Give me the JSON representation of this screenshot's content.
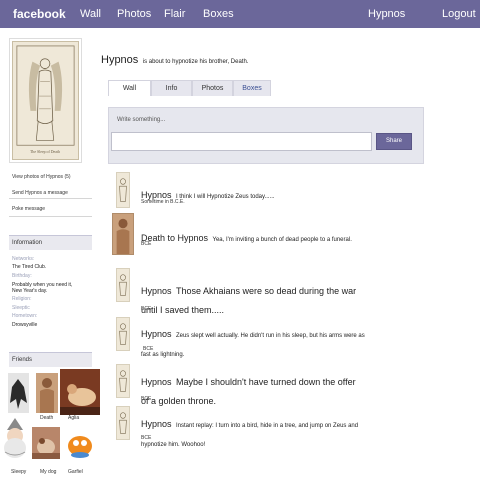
{
  "topbar": {
    "logo": "facebook",
    "nav": [
      "Wall",
      "Photos",
      "Flair",
      "Boxes"
    ],
    "profile_link": "Hypnos",
    "logout": "Logout"
  },
  "profile": {
    "name": "Hypnos",
    "status": "is about to hypnotize his brother, Death.",
    "portrait_caption": "The Sleep of Death"
  },
  "sidebar": {
    "links": [
      "View photos of Hypnos (5)",
      "Send Hypnos a message",
      "Poke message"
    ],
    "info_header": "Information",
    "info": [
      {
        "label": "Networks:",
        "value": "The Tired Club."
      },
      {
        "label": "Birthday:",
        "value": "Probably when you need it, New Year's day."
      },
      {
        "label": "Religion:",
        "value": ""
      },
      {
        "label": "Sleeptic",
        "value": ""
      },
      {
        "label": "Hometown:",
        "value": "Drowsyville"
      }
    ],
    "friends_header": "Friends",
    "friends": [
      {
        "name": "Death"
      },
      {
        "name": "Aglia"
      },
      {
        "name": "Sleepy"
      },
      {
        "name": "My dog"
      },
      {
        "name": "Garfiel"
      }
    ]
  },
  "tabs": [
    "Wall",
    "Info",
    "Photos",
    "Boxes"
  ],
  "composer": {
    "label": "Write something...",
    "placeholder": "",
    "share": "Share"
  },
  "posts": [
    {
      "author": "Hypnos",
      "text": "I think I will Hypnotize Zeus today......",
      "time": "Sometime in B.C.E."
    },
    {
      "author": "Death to Hypnos",
      "text": "Yea, I'm inviting a bunch of dead people to a funeral.",
      "time": "BCE"
    },
    {
      "author": "Hypnos",
      "text": "Those Akhaians were so dead during the war until I saved them.....",
      "time": "BCE"
    },
    {
      "author": "Hypnos",
      "text": "Zeus slept well actually. He didn't run in his sleep, but his arms were as fast as lightning.",
      "time": "BCE"
    },
    {
      "author": "Hypnos",
      "text": "Maybe I shouldn't have turned down the offer of a golden throne.",
      "time": "BCE"
    },
    {
      "author": "Hypnos",
      "text": "Instant replay: I turn into a bird, hide in a tree, and jump on Zeus and hypnotize him. Woohoo!",
      "time": "BCE"
    }
  ],
  "colors": {
    "brand": "#6b679a",
    "tab_bg": "#e6e6ee",
    "composer_bg": "#e6e7ee"
  }
}
